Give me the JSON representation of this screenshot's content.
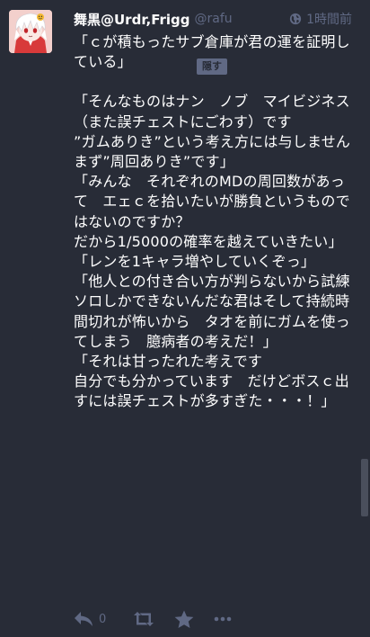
{
  "status": {
    "display_name": "舞黒@Urdr,Frigg",
    "acct": "@rafu",
    "time": "1時間前",
    "visibility_icon": "globe-icon",
    "spoiler_text": "「ｃが積もったサブ倉庫が君の運を証明している」",
    "spoiler_button": "隠す",
    "paragraphs": [
      "「そんなものはナン　ノブ　マイビジネス（また誤チェストにごわす）です",
      "”ガムありき”という考え方には与しません",
      "まず”周回ありき”です」",
      "「みんな　それぞれのMDの周回数があって　エェｃを拾いたいが勝負というものではないのですか？",
      "だから1/5000の確率を越えていきたい」",
      "「レンを1キャラ増やしていくぞっ」",
      "「他人との付き合い方が判らないから試練ソロしかできないんだな君はそして持続時間切れが怖いから　タオを前にガムを使ってしまう　臆病者の考えだ！」",
      "「それは甘ったれた考えです",
      "自分でも分かっています　だけどボスｃ出すには誤チェストが多すぎた・・・！」"
    ],
    "actions": {
      "reply_icon": "reply-icon",
      "reply_count": "0",
      "boost_icon": "boost-icon",
      "favourite_icon": "star-icon",
      "more_icon": "more-icon"
    }
  },
  "colors": {
    "background": "#282c37",
    "muted": "#606984",
    "text": "#ffffff"
  }
}
